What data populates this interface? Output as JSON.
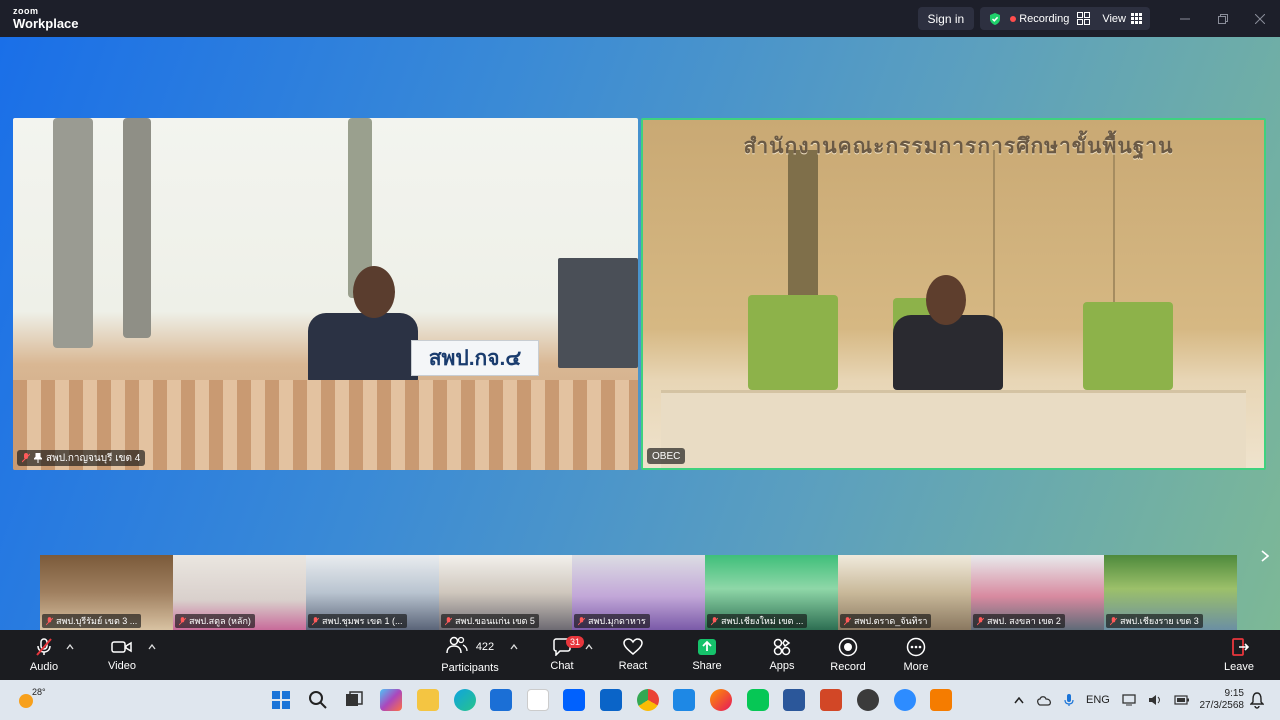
{
  "app": {
    "brand_small": "zoom",
    "brand_large": "Workplace"
  },
  "titlebar": {
    "signin": "Sign in",
    "recording": "Recording",
    "view": "View"
  },
  "videos": {
    "left": {
      "name": "สพป.กาญจนบุรี เขต 4",
      "sign": "สพป.กจ.๔"
    },
    "right": {
      "name": "OBEC",
      "banner": "สำนักงานคณะกรรมการการศึกษาขั้นพื้นฐาน"
    }
  },
  "filmstrip": [
    {
      "name": "สพป.บุรีรัมย์ เขต 3 ..."
    },
    {
      "name": "สพป.สตูล (หลัก)"
    },
    {
      "name": "สพป.ชุมพร เขต 1 (..."
    },
    {
      "name": "สพป.ขอนแก่น เขต 5"
    },
    {
      "name": "สพป.มุกดาหาร"
    },
    {
      "name": "สพป.เชียงใหม่ เขต ..."
    },
    {
      "name": "สพป.ตราด_จันทิรา"
    },
    {
      "name": "สพป. สงขลา เขต 2"
    },
    {
      "name": "สพป.เชียงราย เขต 3"
    }
  ],
  "toolbar": {
    "audio": "Audio",
    "video": "Video",
    "participants": "Participants",
    "participants_count": "422",
    "chat": "Chat",
    "chat_badge": "31",
    "react": "React",
    "share": "Share",
    "apps": "Apps",
    "record": "Record",
    "more": "More",
    "leave": "Leave"
  },
  "taskbar": {
    "weather": "28°",
    "lang": "ENG",
    "time": "9:15",
    "date": "27/3/2568"
  },
  "colors": {
    "active_speaker": "#3fd17f",
    "leave": "#e8363c",
    "share": "#16c26b"
  }
}
